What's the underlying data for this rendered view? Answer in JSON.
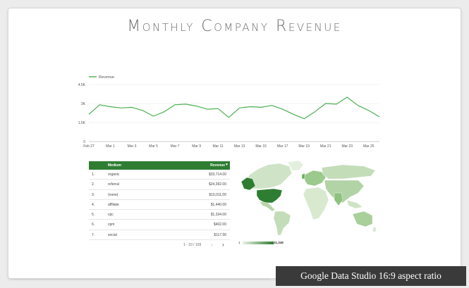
{
  "report": {
    "title": "Monthly Company Revenue"
  },
  "chart_data": {
    "type": "line",
    "legend": "Revenue",
    "legend_position": "top-left",
    "grid": true,
    "ylim": [
      0,
      4500
    ],
    "y_ticks": [
      "0",
      "1.5K",
      "3K",
      "4.5K"
    ],
    "x_labels": [
      "Feb 27",
      "Mar 1",
      "Mar 3",
      "Mar 5",
      "Mar 7",
      "Mar 9",
      "Mar 11",
      "Mar 13",
      "Mar 15",
      "Mar 17",
      "Mar 19",
      "Mar 21",
      "Mar 23",
      "Mar 25"
    ],
    "series": [
      {
        "name": "Revenue",
        "color": "#4caf50",
        "values": [
          2150,
          2900,
          2750,
          2650,
          2700,
          2450,
          2000,
          2350,
          2900,
          2950,
          2800,
          2550,
          2600,
          1900,
          2650,
          2750,
          2700,
          2850,
          2550,
          2150,
          1800,
          2350,
          3000,
          2950,
          3500,
          2850,
          2450,
          1950
        ]
      }
    ]
  },
  "table": {
    "header_medium": "Medium",
    "header_revenue": "Revenue",
    "sort_icon": "▼",
    "rows": [
      {
        "index": "1.",
        "medium": "organic",
        "revenue": "$33,714.00"
      },
      {
        "index": "2.",
        "medium": "referral",
        "revenue": "$24,392.00"
      },
      {
        "index": "3.",
        "medium": "(none)",
        "revenue": "$10,011.00"
      },
      {
        "index": "4.",
        "medium": "affiliate",
        "revenue": "$1,440.00"
      },
      {
        "index": "5.",
        "medium": "cpc",
        "revenue": "$1,334.00"
      },
      {
        "index": "6.",
        "medium": "cpm",
        "revenue": "$402.00"
      },
      {
        "index": "7.",
        "medium": "social",
        "revenue": "$117.00"
      }
    ],
    "pager_label": "1 - 10 / 103",
    "prev_icon": "‹",
    "next_icon": "›"
  },
  "map": {
    "legend_min": "1",
    "legend_max": "31,348",
    "color_low": "#dcebd5",
    "color_high": "#2e7d32"
  },
  "caption": "Google Data Studio 16:9 aspect ratio"
}
